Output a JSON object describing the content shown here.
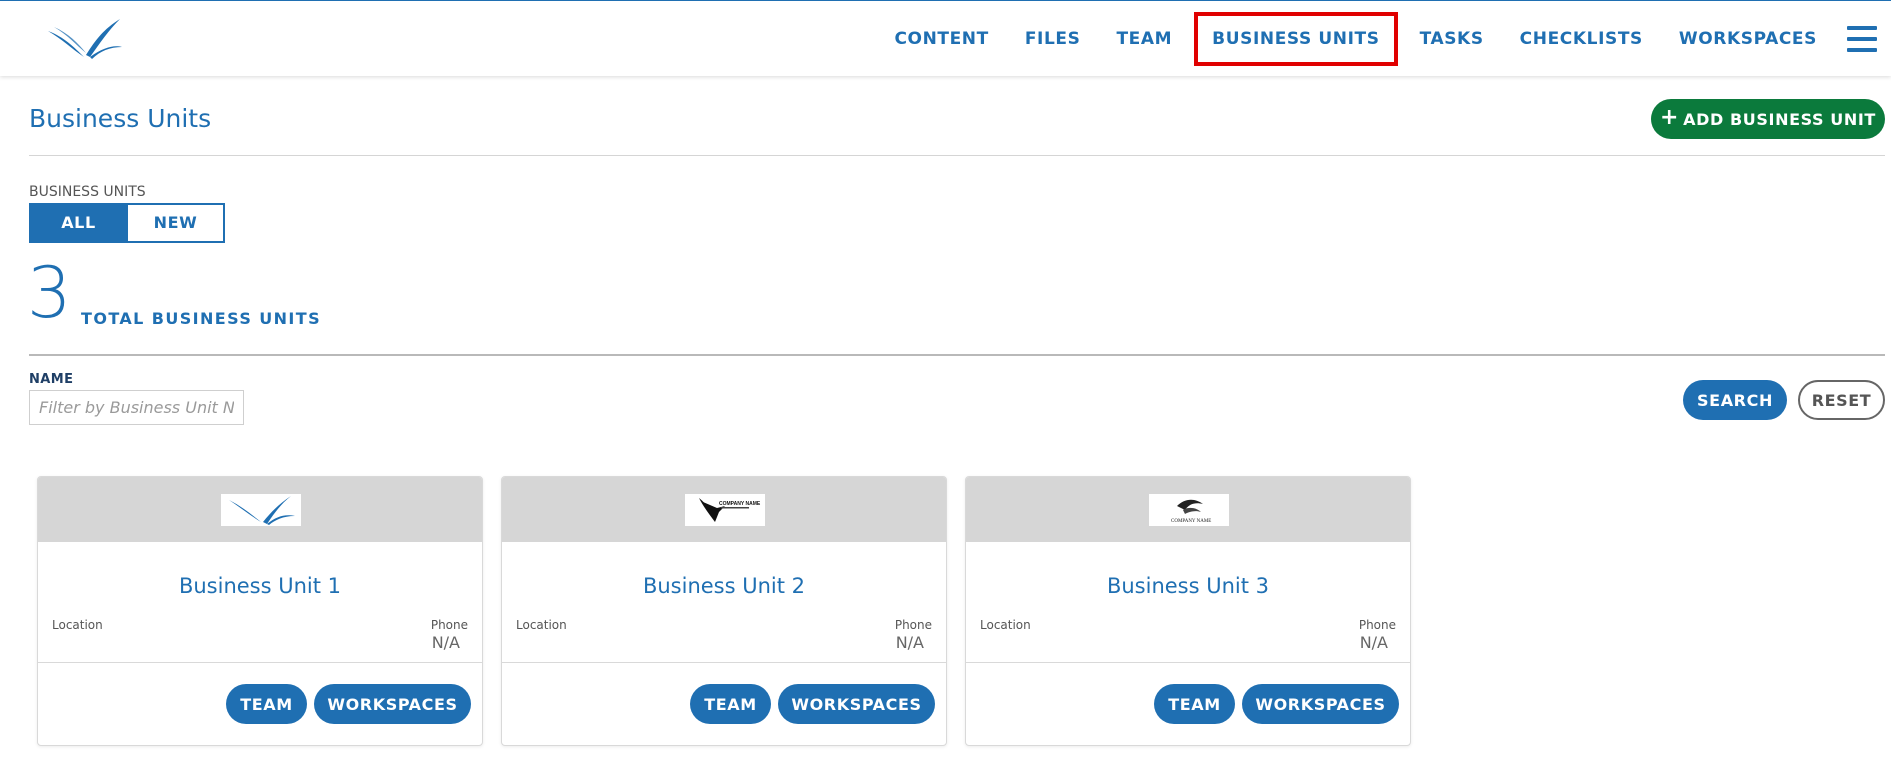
{
  "nav": {
    "items": [
      "CONTENT",
      "FILES",
      "TEAM",
      "BUSINESS UNITS",
      "TASKS",
      "CHECKLISTS",
      "WORKSPACES"
    ],
    "active": "BUSINESS UNITS",
    "menu_icon": "hamburger-menu-icon",
    "logo_icon": "bird-wings-logo"
  },
  "page": {
    "title": "Business Units",
    "add_button": "ADD BUSINESS UNIT",
    "add_icon": "plus-icon"
  },
  "filter": {
    "group_label": "BUSINESS UNITS",
    "options": [
      "ALL",
      "NEW"
    ],
    "selected": "ALL"
  },
  "summary": {
    "count": "3",
    "label": "TOTAL BUSINESS UNITS"
  },
  "search": {
    "name_label": "NAME",
    "placeholder": "Filter by Business Unit Name",
    "value": "",
    "search_button": "SEARCH",
    "reset_button": "RESET"
  },
  "cards": [
    {
      "name": "Business Unit 1",
      "location_label": "Location",
      "phone_label": "Phone",
      "phone": "N/A",
      "team_button": "TEAM",
      "workspaces_button": "WORKSPACES",
      "logo_icon": "blue-wings-logo"
    },
    {
      "name": "Business Unit 2",
      "location_label": "Location",
      "phone_label": "Phone",
      "phone": "N/A",
      "team_button": "TEAM",
      "workspaces_button": "WORKSPACES",
      "logo_icon": "black-bird-company-logo",
      "logo_text": "COMPANY NAME"
    },
    {
      "name": "Business Unit 3",
      "location_label": "Location",
      "phone_label": "Phone",
      "phone": "N/A",
      "team_button": "TEAM",
      "workspaces_button": "WORKSPACES",
      "logo_icon": "eagle-company-logo",
      "logo_text": "COMPANY NAME"
    }
  ],
  "colors": {
    "primary": "#1f6fb2",
    "add_green": "#0b7a3c",
    "highlight_red": "#e00000",
    "card_header": "#d6d6d6"
  }
}
